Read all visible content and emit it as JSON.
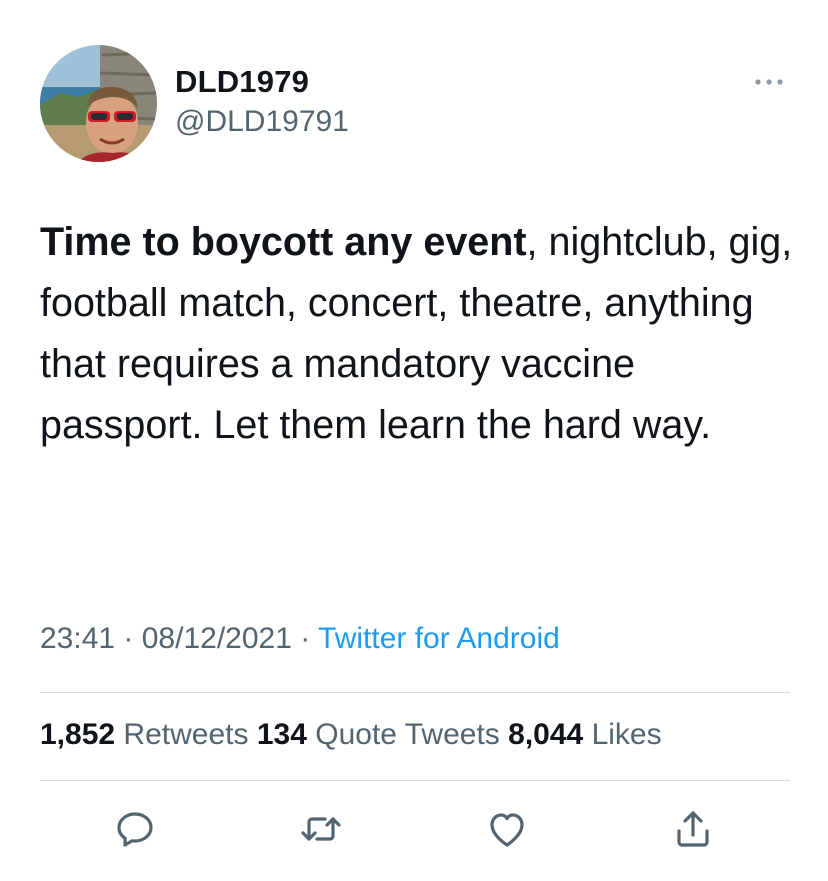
{
  "author": {
    "display_name": "DLD1979",
    "handle": "@DLD19791"
  },
  "tweet": {
    "text_bold": "Time to boycott any event",
    "text_rest": ", nightclub, gig, football match, concert, theatre, anything that requires a mandatory vaccine passport. Let them learn the hard way.",
    "time": "23:41",
    "separator_1": " · ",
    "date": "08/12/2021",
    "separator_2": " · ",
    "source": "Twitter for Android"
  },
  "stats": {
    "retweets_count": "1,852",
    "retweets_label": "Retweets",
    "quotes_count": "134",
    "quotes_label": "Quote Tweets",
    "likes_count": "8,044",
    "likes_label": "Likes"
  },
  "colors": {
    "text": "#0f1419",
    "secondary": "#536471",
    "link": "#1d9bf0",
    "divider": "#d9dee2"
  },
  "icons": {
    "more": "more-dots-icon",
    "reply": "reply-icon",
    "retweet": "retweet-icon",
    "like": "heart-icon",
    "share": "share-icon"
  }
}
